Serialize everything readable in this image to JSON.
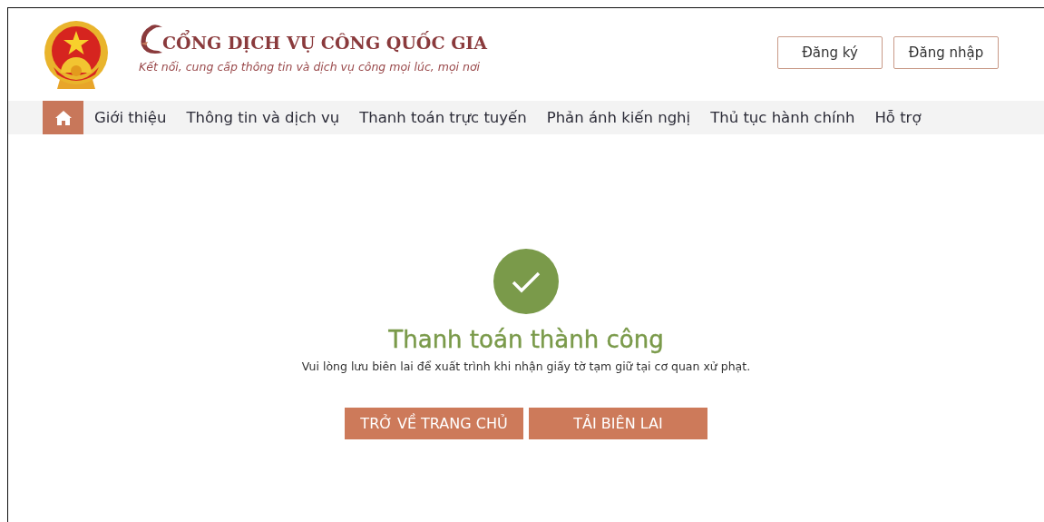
{
  "header": {
    "title": "CỔNG DỊCH VỤ CÔNG QUỐC GIA",
    "subtitle": "Kết nối, cung cấp thông tin và dịch vụ công mọi lúc, mọi nơi",
    "buttons": [
      "Đăng ký",
      "Đăng nhập"
    ]
  },
  "nav": {
    "items": [
      "Giới thiệu",
      "Thông tin và dịch vụ",
      "Thanh toán trực tuyến",
      "Phản ánh kiến nghị",
      "Thủ tục hành chính",
      "Hỗ trợ"
    ]
  },
  "result": {
    "title": "Thanh toán thành công",
    "message": "Vui lòng lưu biên lai để xuất trình khi nhận giấy tờ tạm giữ tại cơ quan xử phạt.",
    "buttons": [
      "TRỞ VỀ TRANG CHỦ",
      "TẢI BIÊN LAI"
    ]
  }
}
